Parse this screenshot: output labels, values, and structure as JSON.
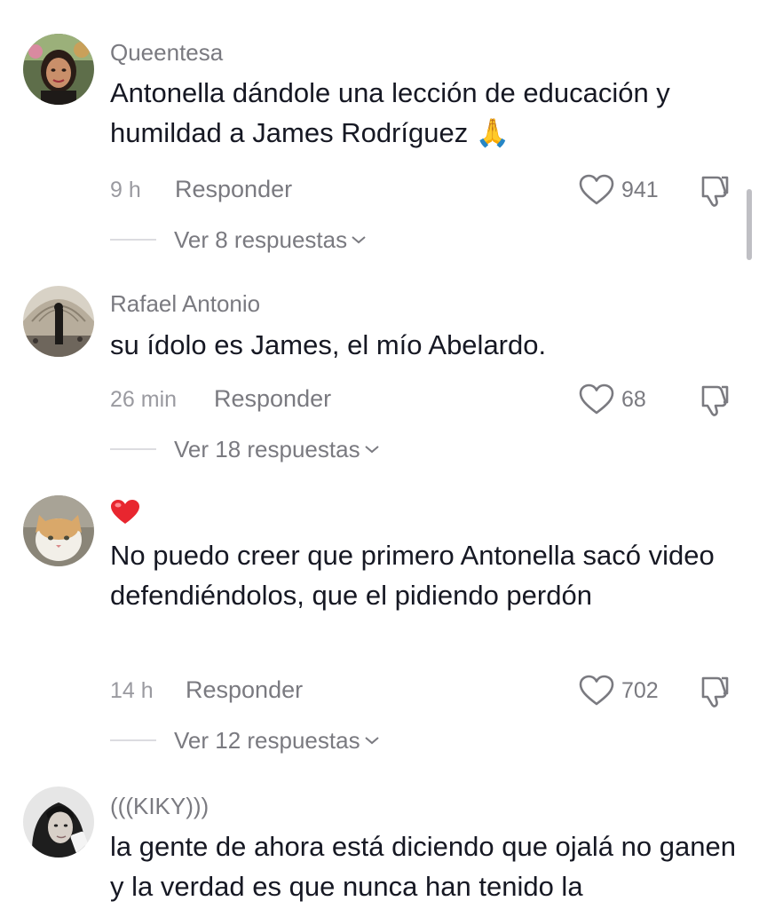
{
  "comments": [
    {
      "username": "Queentesa",
      "text": "Antonella dándole una lección de educación y humildad a James Rodríguez 🙏",
      "time": "9 h",
      "reply_label": "Responder",
      "likes": "941",
      "replies_label": "Ver 8 respuestas"
    },
    {
      "username": "Rafael Antonio",
      "text": "su ídolo es James, el mío Abelardo.",
      "time": "26 min",
      "reply_label": "Responder",
      "likes": "68",
      "replies_label": "Ver 18 respuestas"
    },
    {
      "username": "❤️",
      "text": "No puedo creer que primero Antonella sacó video defendiéndolos, que el pidiendo perdón",
      "time": "14 h",
      "reply_label": "Responder",
      "likes": "702",
      "replies_label": "Ver 12 respuestas"
    },
    {
      "username": "(((KIKY)))",
      "text": "la gente de ahora está diciendo que ojalá no ganen y la verdad es que nunca han tenido la"
    }
  ],
  "icons": {
    "like": "heart-outline-icon",
    "dislike": "thumbs-down-icon",
    "expand": "chevron-down-icon"
  },
  "colors": {
    "text": "#161823",
    "secondary": "#7a7a80",
    "heart_red": "#e8262f"
  }
}
